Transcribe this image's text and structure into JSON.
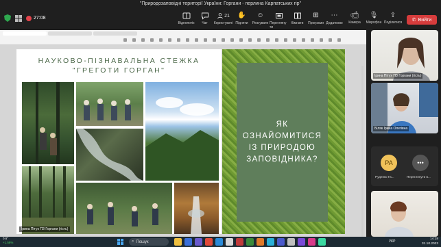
{
  "window": {
    "title": "\"Природозаповідні території України: Горгани - перлина Карпатських гір\""
  },
  "recording": {
    "time": "27:08"
  },
  "toolbar": {
    "items": [
      {
        "label": "Відеопотік",
        "icon": "camera-grid-icon"
      },
      {
        "label": "Чат",
        "icon": "chat-icon"
      },
      {
        "label": "Користувачі",
        "icon": "people-icon",
        "count": "21"
      },
      {
        "label": "Підняти",
        "icon": "raise-hand-icon"
      },
      {
        "label": "Реагувати",
        "icon": "react-icon"
      },
      {
        "label": "Перегляну ти",
        "icon": "view-icon"
      },
      {
        "label": "Кімнати",
        "icon": "rooms-icon"
      },
      {
        "label": "Програми",
        "icon": "apps-icon"
      },
      {
        "label": "Додатково",
        "icon": "more-icon"
      }
    ],
    "camera_label": "Камера",
    "mic_label": "Мікрофон",
    "share_label": "Поділитися",
    "leave_label": "Вийти"
  },
  "slide": {
    "title_line1": "НАУКОВО-ПІЗНАВАЛЬНА СТЕЖКА",
    "title_line2": "\"ГРЕГОТИ ГОРГАН\"",
    "panel_text": "ЯК\nОЗНАЙОМИТИСЯ\nІЗ ПРИРОДОЮ\nЗАПОВІДНИКА?"
  },
  "presenter_tag": "Ірина Пітух ПЗ Горгани (гість)",
  "participants": [
    {
      "name": "Ірина Пітух ПЗ Горгани (гість)"
    },
    {
      "name": "Біляк Ірина Олегівна"
    },
    {
      "name": "Руденко Га...",
      "initials": "РА",
      "color": "#f0c25a"
    },
    {
      "name": "Переглянути в...",
      "initials": "•••",
      "color": "#555555"
    }
  ],
  "taskbar": {
    "weather_temp": "0.6°",
    "weather_change": "+1.58%",
    "search_label": "Пошук",
    "lang": "УКР",
    "time": "14:18",
    "date": "31.10.2023"
  }
}
